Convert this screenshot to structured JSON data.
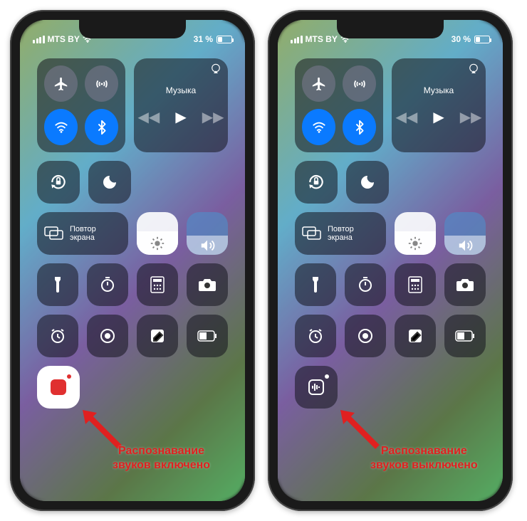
{
  "phones": [
    {
      "carrier": "MTS BY",
      "battery_pct": "31 %",
      "music_label": "Музыка",
      "screen_mirror": "Повтор\nэкрана",
      "sound_rec_state": "on",
      "caption": "Распознавание\nзвуков включено"
    },
    {
      "carrier": "MTS BY",
      "battery_pct": "30 %",
      "music_label": "Музыка",
      "screen_mirror": "Повтор\nэкрана",
      "sound_rec_state": "off",
      "caption": "Распознавание\nзвуков выключено"
    }
  ],
  "icons": {
    "airplane": "airplane-icon",
    "cellular": "cellular-data-icon",
    "wifi": "wifi-icon",
    "bluetooth": "bluetooth-icon",
    "orientation_lock": "orientation-lock-icon",
    "dnd": "do-not-disturb-icon",
    "screen_mirror": "screen-mirror-icon",
    "brightness": "brightness-icon",
    "volume": "volume-icon",
    "flashlight": "flashlight-icon",
    "timer": "timer-icon",
    "calculator": "calculator-icon",
    "camera": "camera-icon",
    "alarm": "alarm-icon",
    "record": "screen-record-icon",
    "notes": "quick-note-icon",
    "low_power": "low-power-icon",
    "sound_recognition": "sound-recognition-icon",
    "airplay": "airplay-icon",
    "prev": "previous-track-icon",
    "play": "play-icon",
    "next": "next-track-icon"
  }
}
